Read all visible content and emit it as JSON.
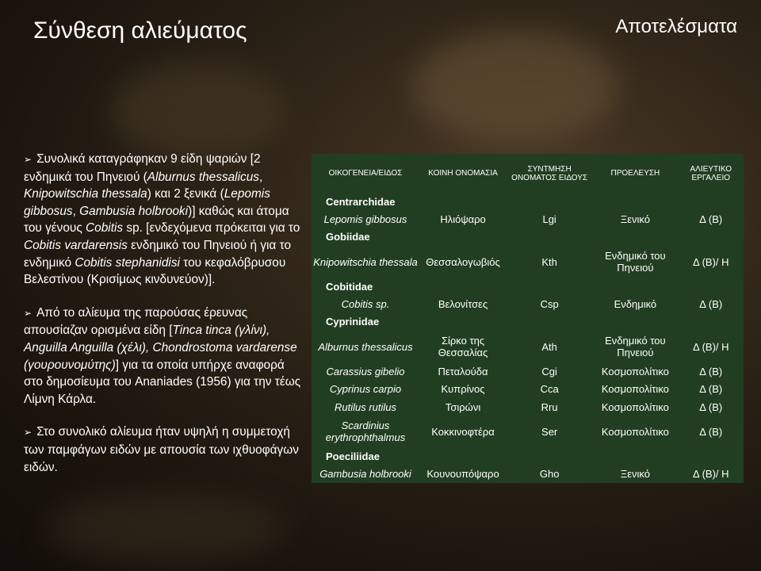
{
  "title": "Σύνθεση αλιεύματος",
  "subtitle": "Αποτελέσματα",
  "bullets": [
    {
      "parts": [
        {
          "t": "Συνολικά καταγράφηκαν 9 είδη ψαριών [2 ενδημικά του Πηνειού (",
          "i": false
        },
        {
          "t": "Alburnus thessalicus",
          "i": true
        },
        {
          "t": ", ",
          "i": false
        },
        {
          "t": "Knipowitschia thessala",
          "i": true
        },
        {
          "t": ") και 2 ξενικά (",
          "i": false
        },
        {
          "t": "Lepomis gibbosus",
          "i": true
        },
        {
          "t": ", ",
          "i": false
        },
        {
          "t": "Gambusia holbrooki",
          "i": true
        },
        {
          "t": ")] καθώς και άτομα του γένους ",
          "i": false
        },
        {
          "t": "Cobitis",
          "i": true
        },
        {
          "t": " sp. [ενδεχόμενα πρόκειται για το ",
          "i": false
        },
        {
          "t": "Cobitis vardarensis",
          "i": true
        },
        {
          "t": " ενδημικό του Πηνειού ή για το ενδημικό ",
          "i": false
        },
        {
          "t": "Cobitis stephanidisi",
          "i": true
        },
        {
          "t": " του κεφαλόβρυσου Βελεστίνου (Κρισίμως κινδυνεύον)].",
          "i": false
        }
      ]
    },
    {
      "parts": [
        {
          "t": "Από το αλίευμα της παρούσας έρευνας απουσίαζαν ορισμένα είδη [",
          "i": false
        },
        {
          "t": "Tinca tinca (γλίνι), Anguilla Anguilla (χέλι), Chondrostoma vardarense (γουρουνομύτης)",
          "i": true
        },
        {
          "t": "] για τα οποία υπήρχε αναφορά στο δημοσίευμα του Ananiades (1956) για την τέως Λίμνη Κάρλα.",
          "i": false
        }
      ]
    },
    {
      "parts": [
        {
          "t": "Στο συνολικό αλίευμα ήταν υψηλή η συμμετοχή των παμφάγων ειδών με απουσία των ιχθυοφάγων ειδών.",
          "i": false
        }
      ]
    }
  ],
  "table": {
    "headers": [
      "ΟΙΚΟΓΕΝΕΙΑ/ΕΙΔΟΣ",
      "ΚΟΙΝΗ ΟΝΟΜΑΣΙΑ",
      "ΣΥΝΤΜΗΣΗ ΟΝΟΜΑΤΟΣ ΕΙΔΟΥΣ",
      "ΠΡΟΕΛΕΥΣΗ",
      "ΑΛΙΕΥΤΙΚΟ ΕΡΓΑΛΕΙΟ"
    ],
    "rows": [
      {
        "family": "Centrarchidae"
      },
      {
        "cells": [
          "Lepomis gibbosus",
          "Ηλιόψαρο",
          "Lgi",
          "Ξενικό",
          "Δ (Β)"
        ]
      },
      {
        "family": "Gobiidae"
      },
      {
        "cells": [
          "Knipowitschia thessala",
          "Θεσσαλογωβιός",
          "Kth",
          "Ενδημικό του Πηνειού",
          "Δ (Β)/ Η"
        ]
      },
      {
        "family": "Cobitidae"
      },
      {
        "cells": [
          "Cobitis sp.",
          "Βελονίτσες",
          "Csp",
          "Ενδημικό",
          "Δ (Β)"
        ]
      },
      {
        "family": "Cyprinidae"
      },
      {
        "cells": [
          "Alburnus thessalicus",
          "Σίρκο της Θεσσαλίας",
          "Ath",
          "Ενδημικό του Πηνειού",
          "Δ (Β)/ Η"
        ]
      },
      {
        "cells": [
          "Carassius gibelio",
          "Πεταλούδα",
          "Cgi",
          "Κοσμοπολίτικο",
          "Δ (Β)"
        ]
      },
      {
        "cells": [
          "Cyprinus carpio",
          "Κυπρίνος",
          "Cca",
          "Κοσμοπολίτικο",
          "Δ (Β)"
        ]
      },
      {
        "cells": [
          "Rutilus rutilus",
          "Τσιρώνι",
          "Rru",
          "Κοσμοπολίτικο",
          "Δ (Β)"
        ]
      },
      {
        "cells": [
          "Scardinius erythrophthalmus",
          "Κοκκινοφτέρα",
          "Ser",
          "Κοσμοπολίτικο",
          "Δ (Β)"
        ]
      },
      {
        "family": "Poeciliidae"
      },
      {
        "cells": [
          "Gambusia holbrooki",
          "Κουνουπόψαρο",
          "Gho",
          "Ξενικό",
          "Δ (Β)/ Η"
        ]
      }
    ]
  }
}
